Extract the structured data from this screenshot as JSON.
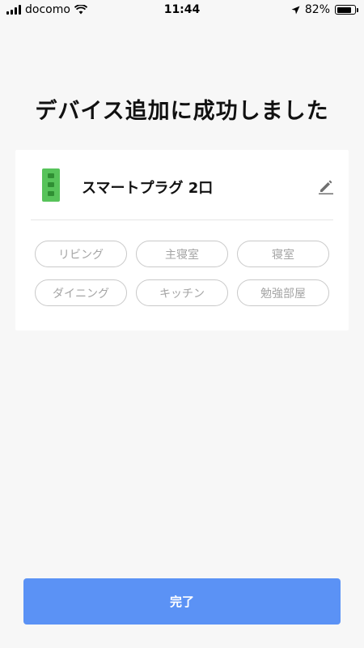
{
  "status_bar": {
    "carrier": "docomo",
    "time": "11:44",
    "battery_percent": "82%",
    "battery_level": 0.82,
    "icons": [
      "signal-icon",
      "wifi-icon",
      "location-arrow-icon",
      "battery-icon"
    ]
  },
  "title": "デバイス追加に成功しました",
  "device": {
    "name": "スマートプラグ 2口",
    "icon": "smart-plug-icon",
    "edit_icon": "pencil-icon",
    "icon_color": "#57c35a"
  },
  "rooms": [
    "リビング",
    "主寝室",
    "寝室",
    "ダイニング",
    "キッチン",
    "勉強部屋"
  ],
  "done_button": {
    "label": "完了",
    "color": "#5b92f5"
  }
}
